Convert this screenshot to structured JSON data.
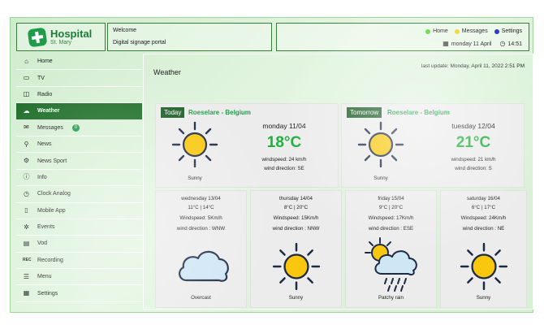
{
  "header": {
    "logo_title": "Hospital",
    "logo_subtitle": "St. Mary",
    "welcome": "Welcome",
    "portal": "Digital signage portal",
    "links": [
      {
        "label": "Home",
        "color": "#5bd63b"
      },
      {
        "label": "Messages",
        "color": "#f2d22b"
      },
      {
        "label": "Settings",
        "color": "#2233c8"
      }
    ],
    "date": "monday 11 April",
    "time": "14:51"
  },
  "sidebar": {
    "items": [
      {
        "label": "Home",
        "icon": "home-icon"
      },
      {
        "label": "TV",
        "icon": "tv-icon"
      },
      {
        "label": "Radio",
        "icon": "radio-icon"
      },
      {
        "label": "Weather",
        "icon": "cloud-icon",
        "active": true
      },
      {
        "label": "Messages",
        "icon": "message-icon",
        "badge": "0"
      },
      {
        "label": "News",
        "icon": "news-icon"
      },
      {
        "label": "News Sport",
        "icon": "sport-icon"
      },
      {
        "label": "Info",
        "icon": "info-icon"
      },
      {
        "label": "Clock Analog",
        "icon": "clock-icon"
      },
      {
        "label": "Mobile App",
        "icon": "phone-icon"
      },
      {
        "label": "Events",
        "icon": "events-icon"
      },
      {
        "label": "Vod",
        "icon": "vod-icon"
      },
      {
        "label": "Recording",
        "icon": "rec-icon"
      },
      {
        "label": "Menu",
        "icon": "menu-icon"
      },
      {
        "label": "Settings",
        "icon": "settings-icon"
      }
    ]
  },
  "main": {
    "title": "Weather",
    "last_update": "last update: Monday, April 11, 2022 2:51 PM",
    "today": {
      "tag": "Today",
      "location": "Roeselare - Belgium",
      "date": "monday 11/04",
      "temp": "18°C",
      "windspeed": "windspeed: 24 km/h",
      "wind_direction": "wind direction: SE",
      "condition": "Sunny"
    },
    "tomorrow": {
      "tag": "Tomorrow",
      "location": "Roeselare - Belgium",
      "date": "tuesday 12/04",
      "temp": "21°C",
      "windspeed": "windspeed: 21 km/h",
      "wind_direction": "wind direction: S",
      "condition": "Sunny"
    },
    "forecast": [
      {
        "date": "wednesday 13/04",
        "temps": "11°C | 14°C",
        "windspeed": "Windspeed: 5Km/h",
        "wind_direction": "wind direction : WNW",
        "condition": "Overcast",
        "icon": "cloud-icon"
      },
      {
        "date": "thursday 14/04",
        "temps": "8°C | 20°C",
        "windspeed": "Windspeed: 15Km/h",
        "wind_direction": "wind direction : NNW",
        "condition": "Sunny",
        "icon": "sun-icon"
      },
      {
        "date": "friday 15/04",
        "temps": "9°C | 20°C",
        "windspeed": "Windspeed: 17Km/h",
        "wind_direction": "wind direction : ESE",
        "condition": "Patchy rain",
        "icon": "patchy-rain-icon"
      },
      {
        "date": "saturday 16/04",
        "temps": "6°C | 17°C",
        "windspeed": "Windspeed: 24Km/h",
        "wind_direction": "wind direction : NE",
        "condition": "Sunny",
        "icon": "sun-icon"
      }
    ]
  }
}
